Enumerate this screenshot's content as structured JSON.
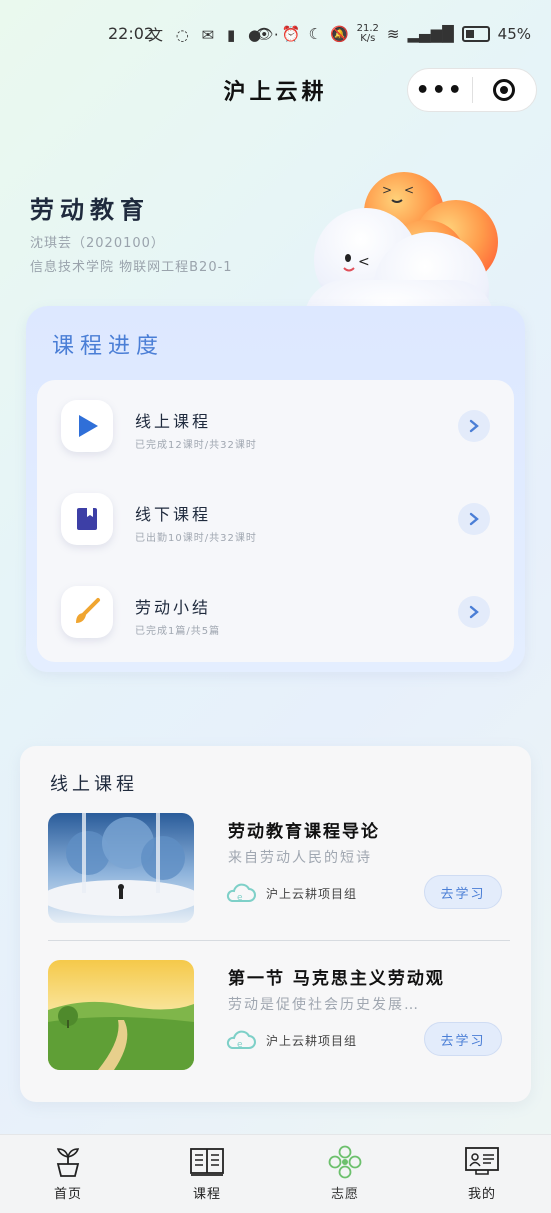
{
  "status_bar": {
    "time": "22:02",
    "left_icons": "文 ◌ ✉ ▮ ● ···",
    "net_speed_value": "21.2",
    "net_speed_unit": "K/s",
    "battery": "45%"
  },
  "header": {
    "title": "沪上云耕",
    "more_label": "•••"
  },
  "profile": {
    "course_name": "劳动教育",
    "student": "沈琪芸（2020100）",
    "college": "信息技术学院 物联网工程B20-1"
  },
  "progress": {
    "title": "课程进度",
    "items": [
      {
        "label": "线上课程",
        "sub": "已完成12课时/共32课时",
        "icon": "play-icon"
      },
      {
        "label": "线下课程",
        "sub": "已出勤10课时/共32课时",
        "icon": "book-icon"
      },
      {
        "label": "劳动小结",
        "sub": "已完成1篇/共5篇",
        "icon": "brush-icon"
      }
    ]
  },
  "online": {
    "title": "线上课程",
    "courses": [
      {
        "name": "劳动教育课程导论",
        "desc": "来自劳动人民的短诗",
        "group": "沪上云耕项目组",
        "button": "去学习"
      },
      {
        "name": "第一节 马克思主义劳动观",
        "desc": "劳动是促使社会历史发展…",
        "group": "沪上云耕项目组",
        "button": "去学习"
      }
    ]
  },
  "tabbar": {
    "tabs": [
      {
        "label": "首页"
      },
      {
        "label": "课程"
      },
      {
        "label": "志愿"
      },
      {
        "label": "我的"
      }
    ]
  },
  "colors": {
    "accent": "#4a7ed6",
    "volunteer_green": "#6cc06c",
    "play_blue": "#2f6fd8",
    "book_indigo": "#3d3fa6",
    "brush_orange": "#f0a530"
  }
}
